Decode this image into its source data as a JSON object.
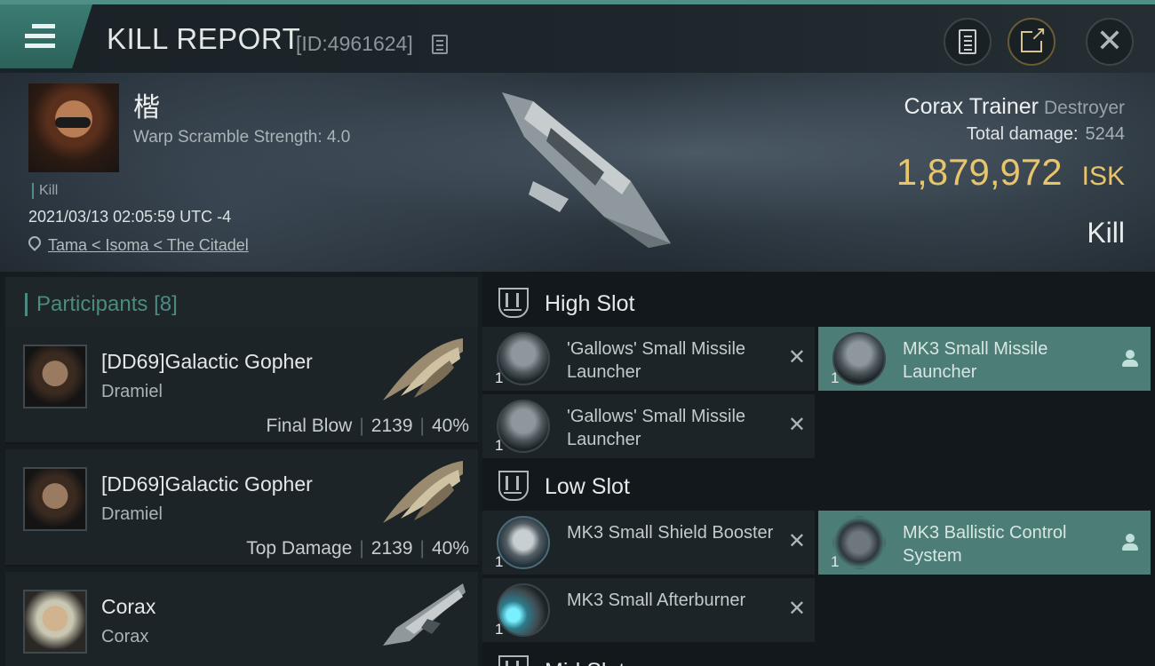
{
  "header": {
    "title": "KILL REPORT",
    "report_id": "[ID:4961624]"
  },
  "victim": {
    "pilot_name": "楷",
    "warp_scramble": "Warp Scramble Strength: 4.0",
    "kill_tag": "Kill",
    "datetime": "2021/03/13 02:05:59 UTC -4",
    "location": "Tama < Isoma < The Citadel",
    "ship_name": "Corax Trainer",
    "ship_class": "Destroyer",
    "total_damage_label": "Total damage:",
    "total_damage_value": "5244",
    "isk_value": "1,879,972",
    "isk_unit": "ISK",
    "result": "Kill"
  },
  "participants": {
    "label": "Participants",
    "count": "[8]",
    "list": [
      {
        "name": "[DD69]Galactic Gopher",
        "ship": "Dramiel",
        "role": "Final Blow",
        "damage": "2139",
        "percent": "40%"
      },
      {
        "name": "[DD69]Galactic Gopher",
        "ship": "Dramiel",
        "role": "Top Damage",
        "damage": "2139",
        "percent": "40%"
      },
      {
        "name": "Corax",
        "ship": "Corax"
      }
    ]
  },
  "fitting": {
    "high_slot": {
      "label": "High Slot",
      "modules": [
        {
          "name": "'Gallows' Small Missile Launcher",
          "qty": "1",
          "status": "destroyed"
        },
        {
          "name": "MK3 Small Missile Launcher",
          "qty": "1",
          "status": "dropped"
        },
        {
          "name": "'Gallows' Small Missile Launcher",
          "qty": "1",
          "status": "destroyed"
        }
      ]
    },
    "low_slot": {
      "label": "Low Slot",
      "modules": [
        {
          "name": "MK3 Small Shield Booster",
          "qty": "1",
          "status": "destroyed"
        },
        {
          "name": "MK3 Ballistic Control System",
          "qty": "1",
          "status": "dropped"
        },
        {
          "name": "MK3 Small Afterburner",
          "qty": "1",
          "status": "destroyed"
        }
      ]
    },
    "mid_slot": {
      "label": "Mid Slot"
    }
  },
  "icons": {
    "menu": "menu-icon",
    "copy": "copy-icon",
    "clipboard": "clipboard-icon",
    "share": "share-icon",
    "close": "close-icon",
    "location": "location-pin-icon",
    "slot": "slot-icon",
    "destroyed": "x-icon",
    "dropped": "person-icon"
  },
  "colors": {
    "accent": "#4f8f86",
    "isk": "#e8c46b",
    "dropped_bg": "#4c7d76",
    "panel": "#1c2428"
  }
}
